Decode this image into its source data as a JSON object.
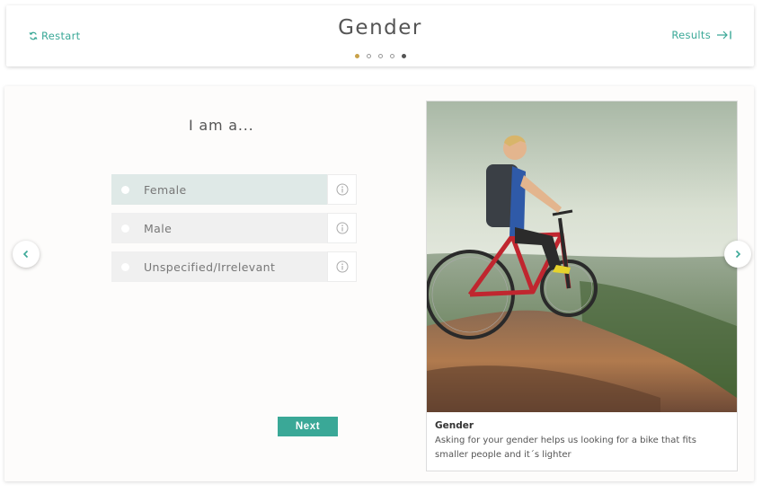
{
  "header": {
    "restart_label": "Restart",
    "title": "Gender",
    "results_label": "Results"
  },
  "progress": {
    "steps": 5,
    "current": 1
  },
  "question": {
    "text": "I am a...",
    "options": [
      {
        "label": "Female",
        "selected": true
      },
      {
        "label": "Male",
        "selected": false
      },
      {
        "label": "Unspecified/Irrelevant",
        "selected": false
      }
    ],
    "next_label": "Next"
  },
  "panel": {
    "caption_title": "Gender",
    "caption_text": "Asking for your gender helps us looking for a bike that fits smaller people and it´s lighter"
  },
  "colors": {
    "accent": "#3aa897",
    "progress_active": "#c9a24a"
  },
  "icons": [
    "restart-icon",
    "results-arrow-icon",
    "info-icon",
    "chevron-left-icon",
    "chevron-right-icon"
  ]
}
